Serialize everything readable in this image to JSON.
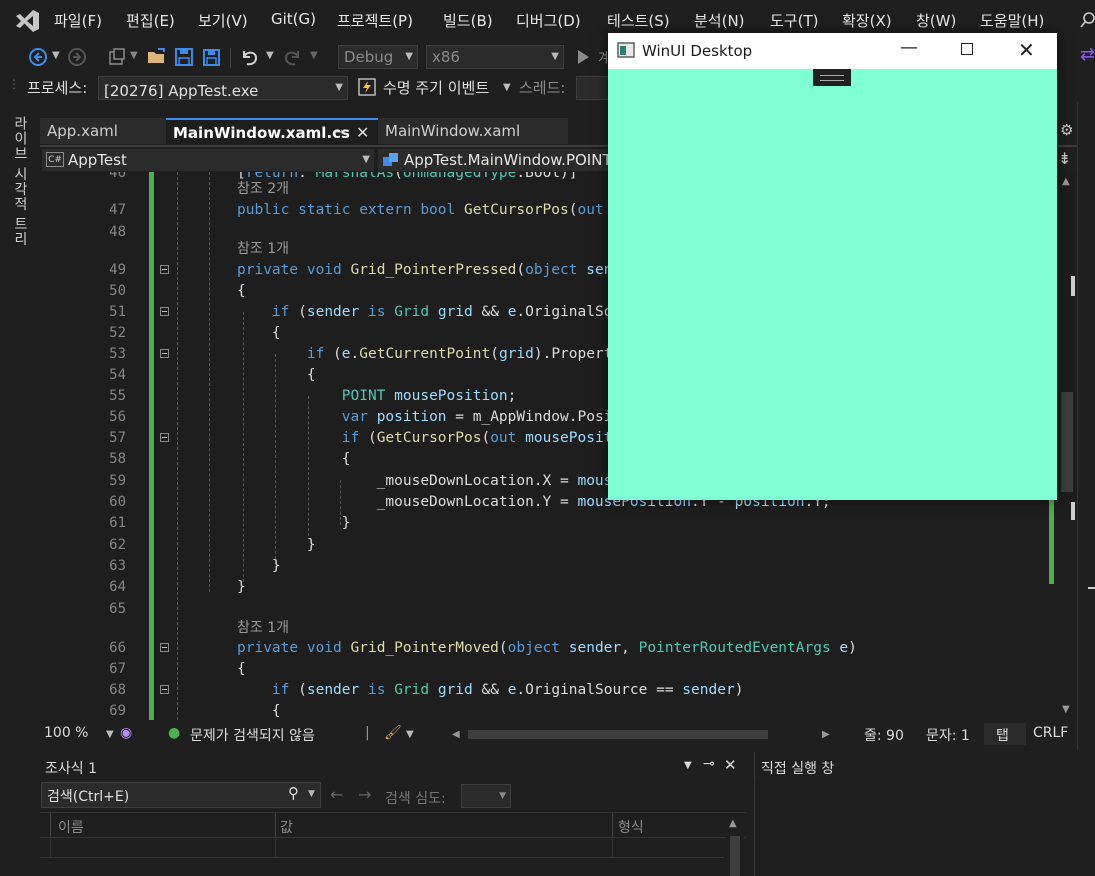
{
  "menu": {
    "items": [
      "파일(F)",
      "편집(E)",
      "보기(V)",
      "Git(G)",
      "프로젝트(P)",
      "빌드(B)",
      "디버그(D)",
      "테스트(S)",
      "분석(N)",
      "도구(T)",
      "확장(X)",
      "창(W)",
      "도움말(H)"
    ]
  },
  "toolbar": {
    "config": "Debug",
    "platform": "x86",
    "continue_label": "계"
  },
  "process_bar": {
    "process_label": "프로세스:",
    "process_value": "[20276] AppTest.exe",
    "lifecycle_label": "수명 주기 이벤트",
    "thread_label": "스레드:"
  },
  "sidebar": {
    "label": "라이브 시각적 트리"
  },
  "tabs": [
    {
      "label": "App.xaml",
      "active": false
    },
    {
      "label": "MainWindow.xaml.cs",
      "active": true
    },
    {
      "label": "MainWindow.xaml",
      "active": false
    }
  ],
  "nav": {
    "project": "AppTest",
    "member": "AppTest.MainWindow.POINT"
  },
  "code": {
    "ref2": "참조 2개",
    "ref1": "참조 1개"
  },
  "status": {
    "zoom": "100 %",
    "issues": "문제가 검색되지 않음",
    "line": "줄: 90",
    "col": "문자: 1",
    "tab": "탭",
    "eol": "CRLF"
  },
  "watch": {
    "title": "조사식 1",
    "search_placeholder": "검색(Ctrl+E)",
    "depth_label": "검색 심도:",
    "col_name": "이름",
    "col_value": "값",
    "col_type": "형식"
  },
  "immediate": {
    "title": "직접 실행 창"
  },
  "app_window": {
    "title": "WinUI Desktop",
    "background": "#7fffd4"
  }
}
